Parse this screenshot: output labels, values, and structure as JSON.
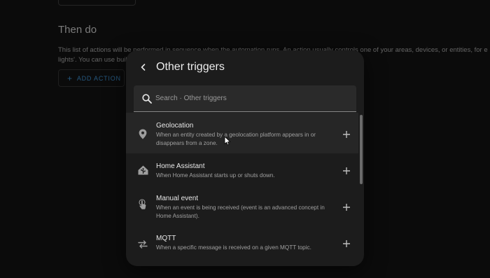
{
  "background": {
    "section_heading": "Then do",
    "paragraph_line1": "This list of actions will be performed in sequence when the automation runs. An action usually controls one of your areas, devices, or entities, for e",
    "paragraph_line2": "lights'. You can use buil",
    "add_action_label": "ADD ACTION"
  },
  "dialog": {
    "title": "Other triggers",
    "search_placeholder": "Search · Other triggers",
    "items": [
      {
        "icon": "map-marker-icon",
        "title": "Geolocation",
        "description": "When an entity created by a geolocation platform appears in or disappears from a zone.",
        "hovered": true
      },
      {
        "icon": "home-assistant-icon",
        "title": "Home Assistant",
        "description": "When Home Assistant starts up or shuts down.",
        "hovered": false
      },
      {
        "icon": "gesture-tap-icon",
        "title": "Manual event",
        "description": "When an event is being received (event is an advanced concept in Home Assistant).",
        "hovered": false
      },
      {
        "icon": "swap-horizontal-icon",
        "title": "MQTT",
        "description": "When a specific message is received on a given MQTT topic.",
        "hovered": false
      }
    ]
  },
  "colors": {
    "background": "#111111",
    "dialog": "#1c1c1c",
    "accent": "#3a86c2",
    "hover": "#262626"
  }
}
